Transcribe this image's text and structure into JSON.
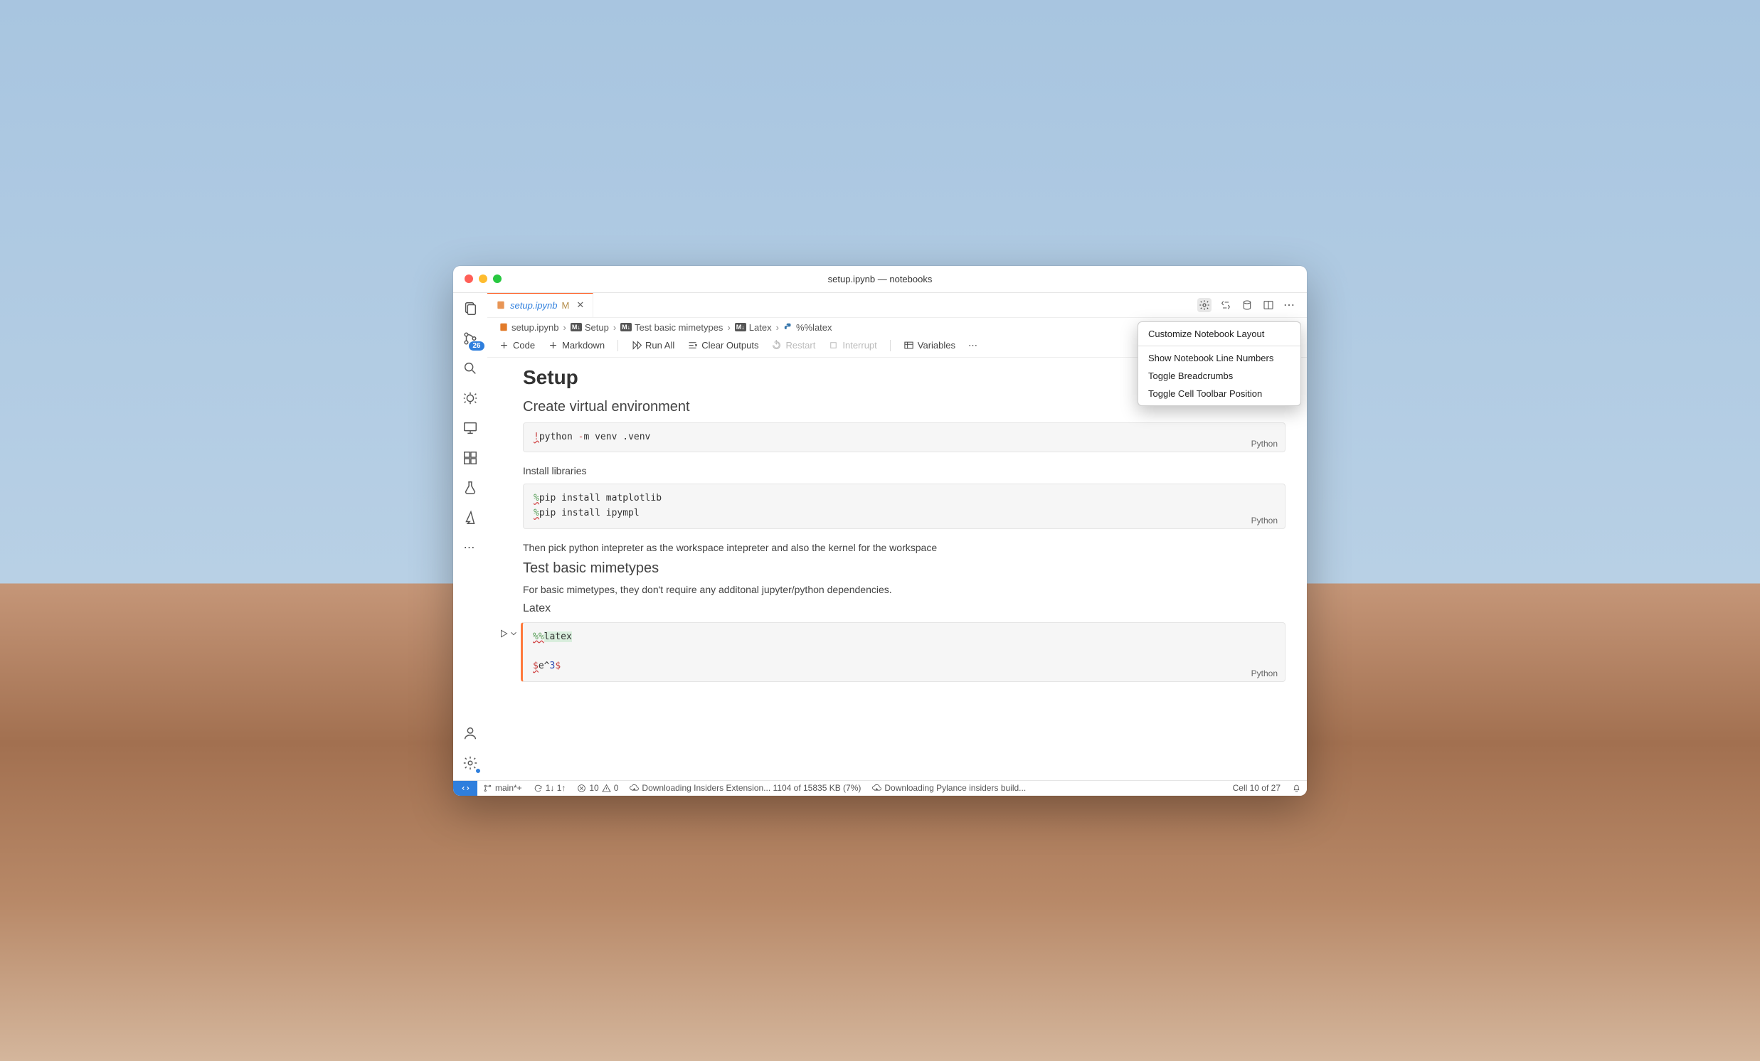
{
  "window": {
    "title": "setup.ipynb — notebooks"
  },
  "activity_badge": "26",
  "tab": {
    "filename": "setup.ipynb",
    "modified_marker": "M",
    "close_glyph": "✕"
  },
  "breadcrumb": {
    "file": "setup.ipynb",
    "seg1": "Setup",
    "seg2": "Test basic mimetypes",
    "seg3": "Latex",
    "seg4": "%%latex"
  },
  "toolbar": {
    "code": "Code",
    "markdown": "Markdown",
    "run_all": "Run All",
    "clear_outputs": "Clear Outputs",
    "restart": "Restart",
    "interrupt": "Interrupt",
    "variables": "Variables",
    "more": "⋯"
  },
  "dropdown": {
    "item1": "Customize Notebook Layout",
    "item2": "Show Notebook Line Numbers",
    "item3": "Toggle Breadcrumbs",
    "item4": "Toggle Cell Toolbar Position"
  },
  "content": {
    "h1": "Setup",
    "h2a": "Create virtual environment",
    "cell1_lang": "Python",
    "cell1": {
      "bang": "!",
      "rest": "python ",
      "dash": "-",
      "flag": "m",
      "rest2": " venv .venv"
    },
    "p1": "Install libraries",
    "cell2_lang": "Python",
    "cell2": {
      "pct": "%",
      "l1": "pip install matplotlib",
      "l2": "pip install ipympl"
    },
    "p2": "Then pick python intepreter as the workspace intepreter and also the kernel for the workspace",
    "h2b": "Test basic mimetypes",
    "p3": "For basic mimetypes, they don't require any additonal jupyter/python dependencies.",
    "h3": "Latex",
    "cell3_lang": "Python",
    "cell3": {
      "pct": "%%",
      "magic": "latex",
      "dol": "$",
      "expr1": "e^",
      "num": "3"
    }
  },
  "status": {
    "branch": "main*+",
    "sync": "1↓ 1↑",
    "errors": "10",
    "warns": "0",
    "dl1": "Downloading Insiders Extension... 1104 of 15835 KB (7%)",
    "dl2": "Downloading Pylance insiders build...",
    "cell_pos": "Cell 10 of 27"
  }
}
